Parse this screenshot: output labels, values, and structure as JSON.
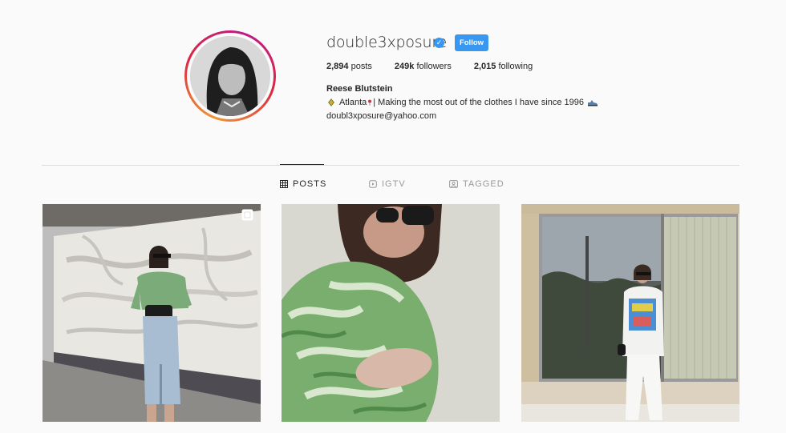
{
  "profile": {
    "username": "double3xposure",
    "follow_label": "Follow",
    "posts_count": "2,894",
    "posts_label": "posts",
    "followers_count": "249k",
    "followers_label": "followers",
    "following_count": "2,015",
    "following_label": "following",
    "full_name": "Reese Blutstein",
    "bio_location": "Atlanta",
    "bio_text": "| Making the most out of the clothes I have since 1996",
    "email": "doubl3xposure@yahoo.com"
  },
  "tabs": {
    "posts": "POSTS",
    "igtv": "IGTV",
    "tagged": "TAGGED"
  },
  "colors": {
    "accent": "#3897f0",
    "text": "#262626",
    "muted": "#999999",
    "background": "#fafafa"
  }
}
